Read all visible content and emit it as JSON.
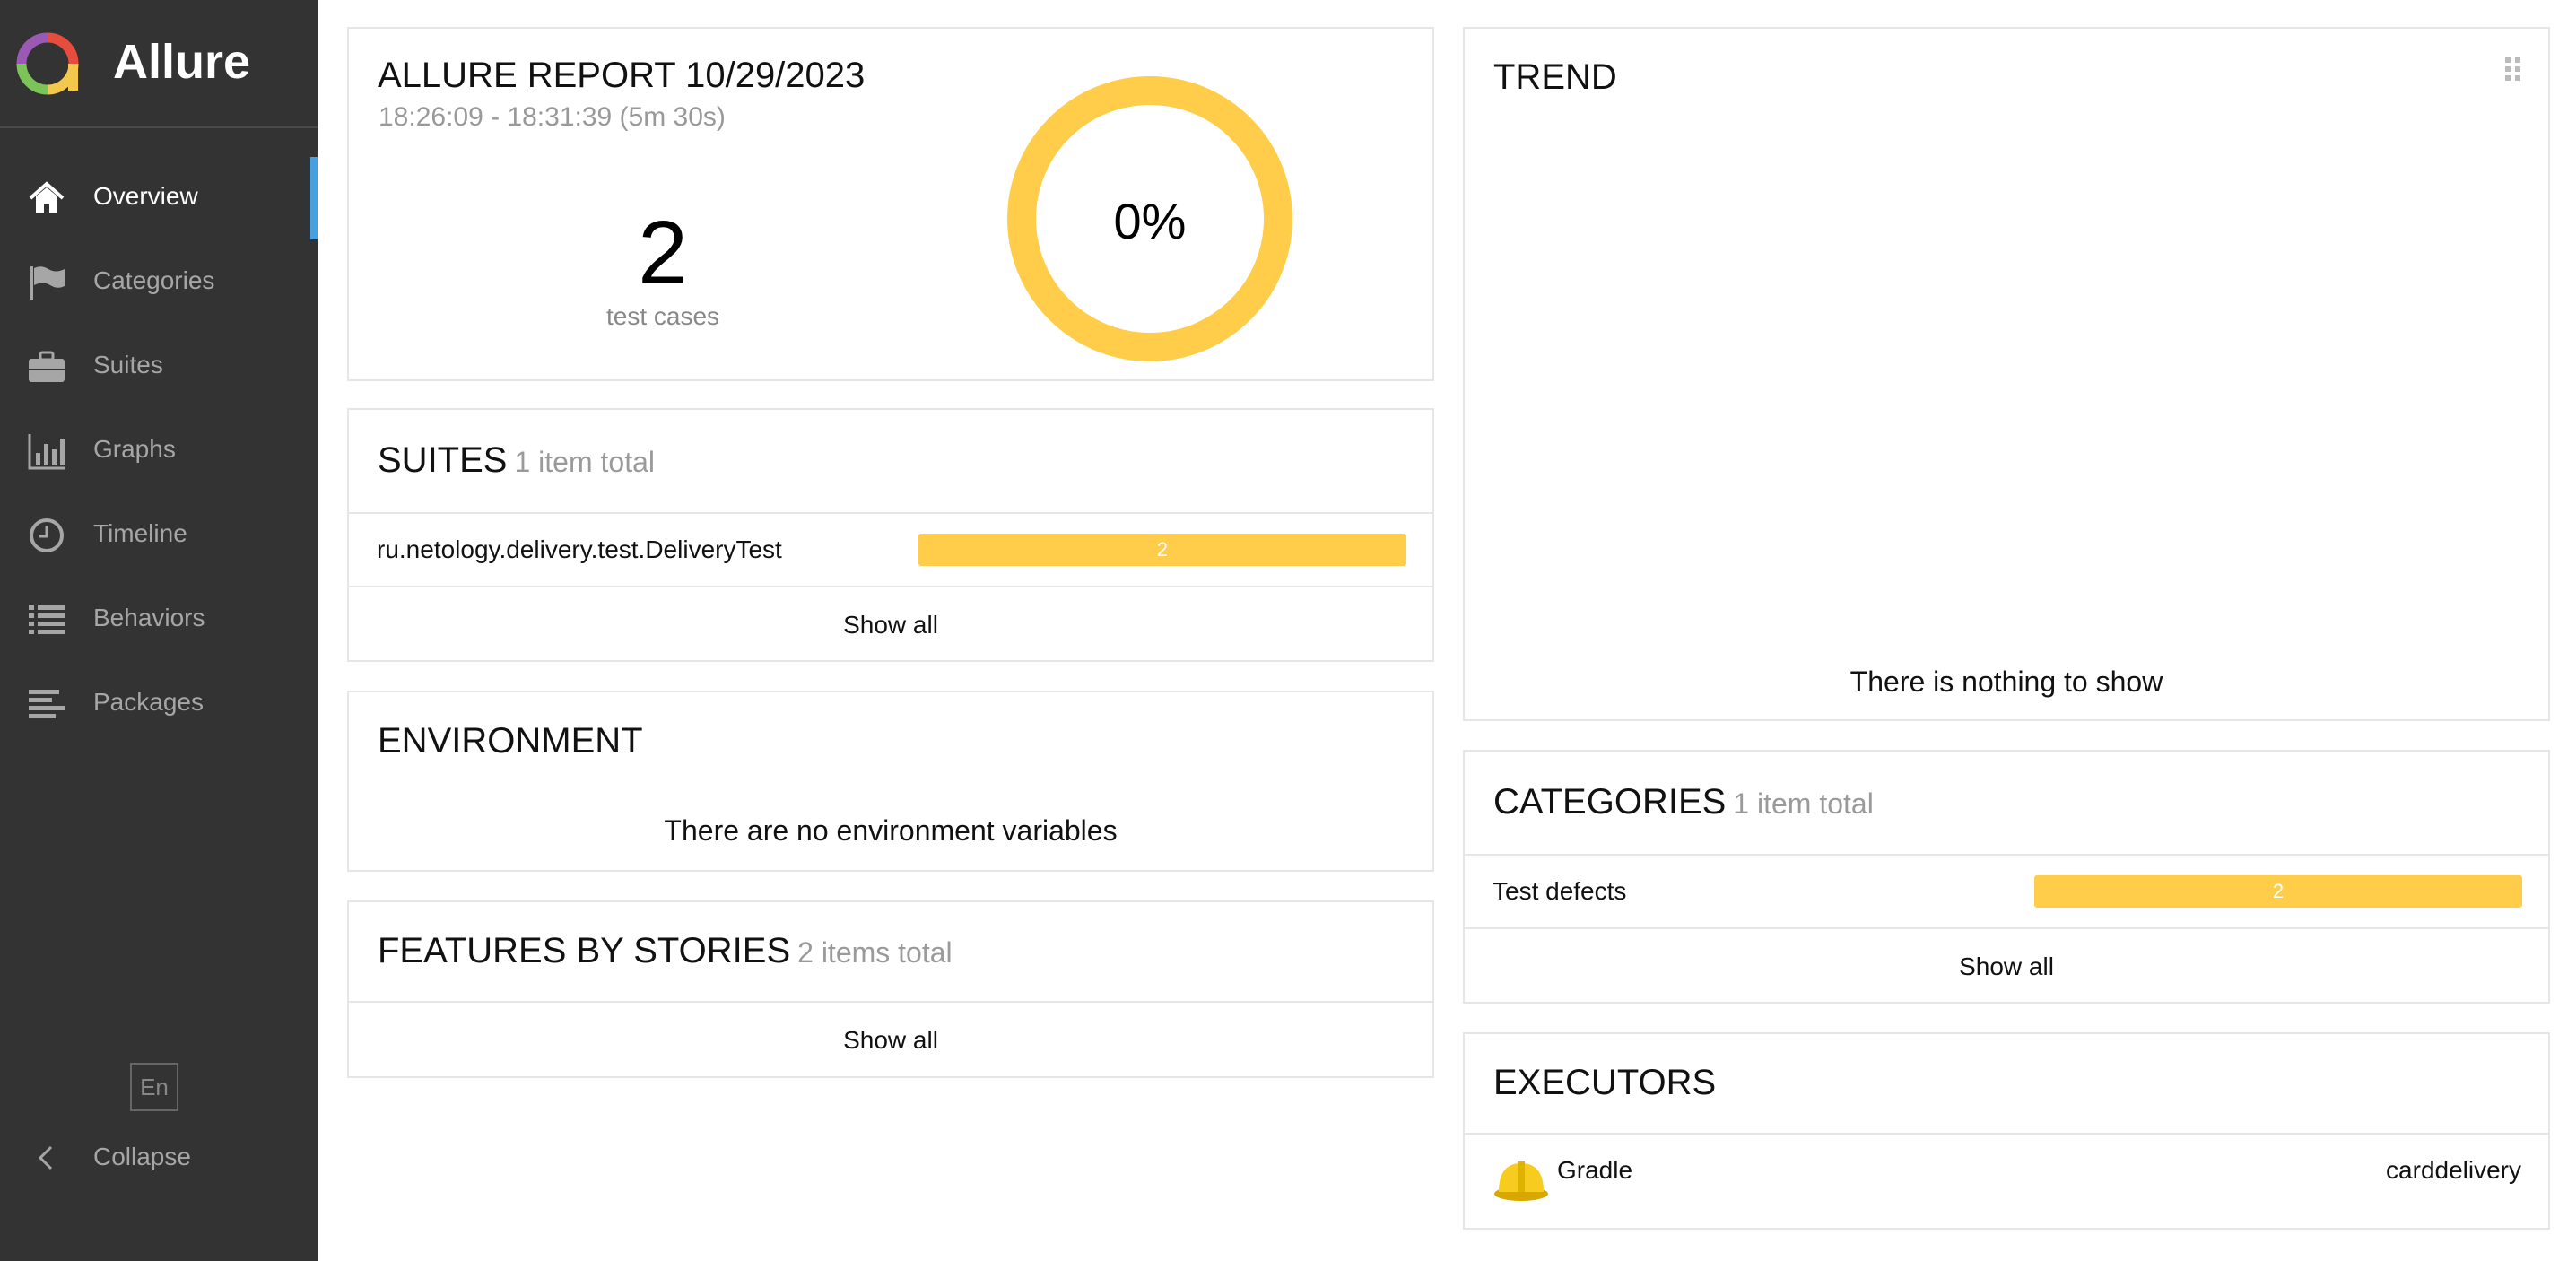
{
  "app": {
    "name": "Allure"
  },
  "sidebar": {
    "items": [
      {
        "label": "Overview",
        "icon": "home-icon"
      },
      {
        "label": "Categories",
        "icon": "flag-icon"
      },
      {
        "label": "Suites",
        "icon": "briefcase-icon"
      },
      {
        "label": "Graphs",
        "icon": "bar-chart-icon"
      },
      {
        "label": "Timeline",
        "icon": "clock-icon"
      },
      {
        "label": "Behaviors",
        "icon": "list-icon"
      },
      {
        "label": "Packages",
        "icon": "align-left-icon"
      }
    ],
    "language": "En",
    "collapse_label": "Collapse"
  },
  "summary": {
    "title": "ALLURE REPORT 10/29/2023",
    "time_range": "18:26:09 - 18:31:39 (5m 30s)",
    "test_count": "2",
    "test_count_label": "test cases",
    "percent": "0%",
    "percent_value": 0
  },
  "suites": {
    "title": "SUITES",
    "total": "1 item total",
    "rows": [
      {
        "name": "ru.netology.delivery.test.DeliveryTest",
        "count": "2"
      }
    ],
    "show_all": "Show all"
  },
  "environment": {
    "title": "ENVIRONMENT",
    "empty": "There are no environment variables"
  },
  "features": {
    "title": "FEATURES BY STORIES",
    "total": "2 items total",
    "show_all": "Show all"
  },
  "trend": {
    "title": "TREND",
    "empty": "There is nothing to show"
  },
  "categories": {
    "title": "CATEGORIES",
    "total": "1 item total",
    "rows": [
      {
        "name": "Test defects",
        "count": "2"
      }
    ],
    "show_all": "Show all"
  },
  "executors": {
    "title": "EXECUTORS",
    "rows": [
      {
        "name": "Gradle",
        "build": "carddelivery",
        "icon": "hard-hat-icon"
      }
    ]
  },
  "colors": {
    "accent": "#ffcd4a",
    "sidebar_bg": "#333333",
    "active_marker": "#45a1e0"
  }
}
